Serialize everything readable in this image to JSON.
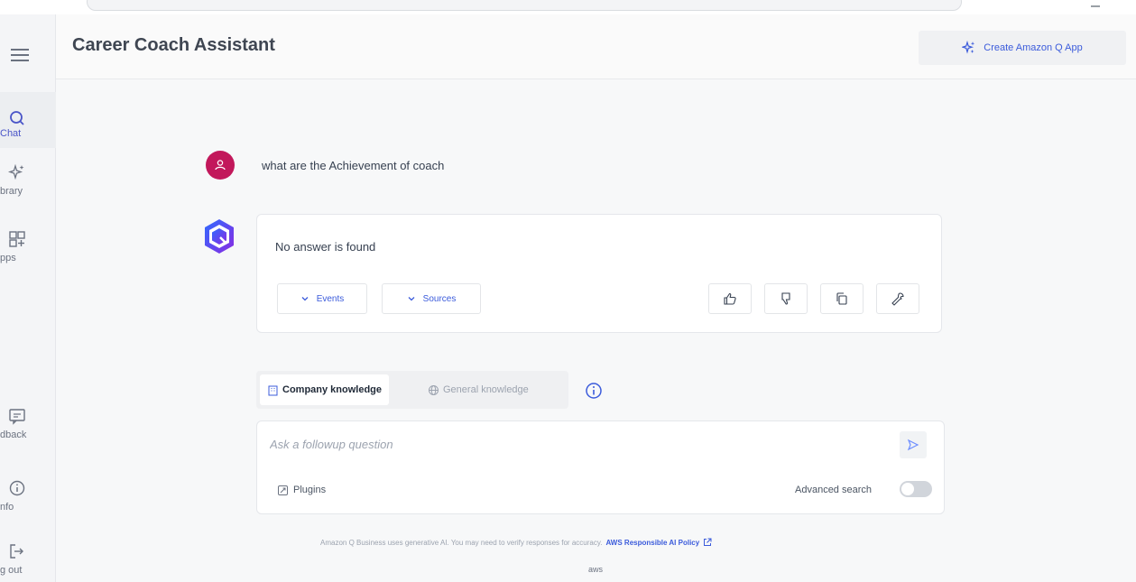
{
  "header": {
    "title": "Career Coach Assistant",
    "create_app_label": "Create Amazon Q App"
  },
  "sidebar": {
    "items": [
      {
        "label": "Chat",
        "icon": "chat-search-icon"
      },
      {
        "label": "brary",
        "icon": "sparkle-icon"
      },
      {
        "label": "pps",
        "icon": "apps-grid-icon"
      },
      {
        "label": "dback",
        "icon": "feedback-icon"
      },
      {
        "label": "nfo",
        "icon": "info-icon"
      },
      {
        "label": "g out",
        "icon": "logout-icon"
      }
    ]
  },
  "conversation": {
    "user_message": "what are the Achievement of coach",
    "bot_answer": "No answer is found",
    "events_label": "Events",
    "sources_label": "Sources"
  },
  "knowledge": {
    "company_label": "Company knowledge",
    "general_label": "General knowledge",
    "selected": "Company knowledge"
  },
  "input": {
    "placeholder": "Ask a followup question",
    "plugins_label": "Plugins",
    "advanced_search_label": "Advanced search",
    "advanced_search_enabled": false
  },
  "footer": {
    "disclaimer": "Amazon Q Business uses generative AI. You may need to verify responses for accuracy.",
    "policy_link": "AWS Responsible AI Policy",
    "brand": "aws"
  },
  "colors": {
    "accent": "#3b5bdb",
    "user_avatar": "#c2185b",
    "bot_avatar": "#5b3fd6"
  }
}
